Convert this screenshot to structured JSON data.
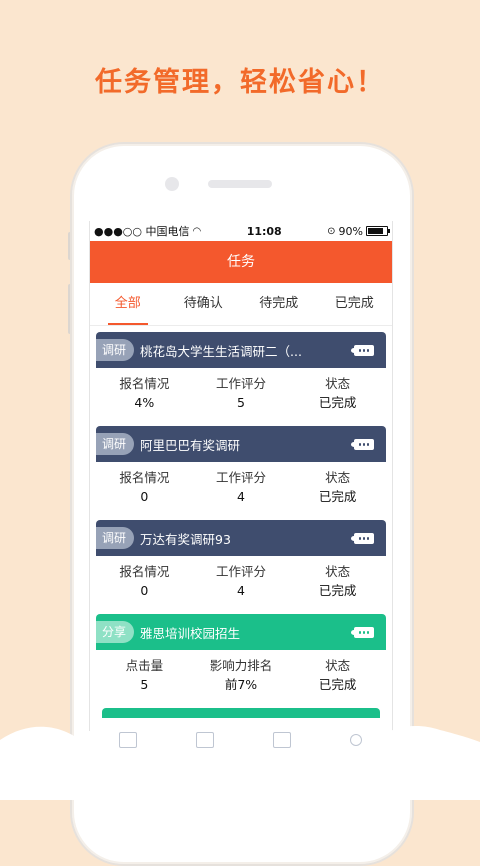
{
  "headline": "任务管理，轻松省心！",
  "status_bar": {
    "carrier": "●●●○○ 中国电信",
    "time": "11:08",
    "battery": "90%"
  },
  "nav": {
    "title": "任务"
  },
  "tabs": [
    {
      "label": "全部",
      "active": true
    },
    {
      "label": "待确认",
      "active": false
    },
    {
      "label": "待完成",
      "active": false
    },
    {
      "label": "已完成",
      "active": false
    }
  ],
  "cards": [
    {
      "tag": "调研",
      "title": "桃花岛大学生生活调研二（...",
      "stats": [
        {
          "label": "报名情况",
          "value": "4%"
        },
        {
          "label": "工作评分",
          "value": "5"
        },
        {
          "label": "状态",
          "value": "已完成"
        }
      ]
    },
    {
      "tag": "调研",
      "title": "阿里巴巴有奖调研",
      "stats": [
        {
          "label": "报名情况",
          "value": "0"
        },
        {
          "label": "工作评分",
          "value": "4"
        },
        {
          "label": "状态",
          "value": "已完成"
        }
      ]
    },
    {
      "tag": "调研",
      "title": "万达有奖调研93",
      "stats": [
        {
          "label": "报名情况",
          "value": "0"
        },
        {
          "label": "工作评分",
          "value": "4"
        },
        {
          "label": "状态",
          "value": "已完成"
        }
      ]
    },
    {
      "tag": "分享",
      "title": "雅思培训校园招生",
      "stats": [
        {
          "label": "点击量",
          "value": "5"
        },
        {
          "label": "影响力排名",
          "value": "前7%"
        },
        {
          "label": "状态",
          "value": "已完成"
        }
      ]
    }
  ],
  "colors": {
    "background": "#fbe6cf",
    "accent": "#f4582d",
    "survey_header": "#3f4d6e",
    "share_header": "#1bbf8a"
  }
}
